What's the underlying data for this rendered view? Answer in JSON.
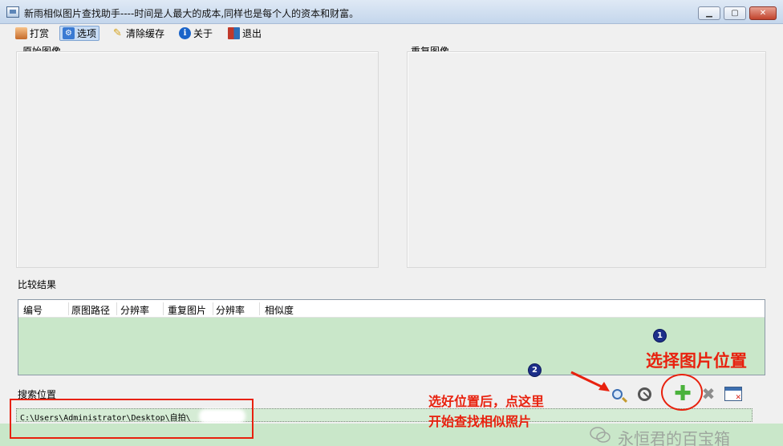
{
  "window": {
    "title": "新雨相似图片查找助手----时间是人最大的成本,同样也是每个人的资本和财富。"
  },
  "menu": [
    {
      "label": "打赏",
      "icon": "reward-icon"
    },
    {
      "label": "选项",
      "icon": "options-icon",
      "active": true
    },
    {
      "label": "清除缓存",
      "icon": "broom-icon"
    },
    {
      "label": "关于",
      "icon": "info-icon"
    },
    {
      "label": "退出",
      "icon": "exit-icon"
    }
  ],
  "panels": {
    "original_label": "原始图像",
    "duplicate_label": "重复图像"
  },
  "results": {
    "label": "比较结果",
    "columns": [
      "编号",
      "原图路径",
      "分辨率",
      "重复图片",
      "分辨率",
      "相似度"
    ],
    "rows": []
  },
  "search": {
    "label": "搜索位置",
    "path": "C:\\Users\\Administrator\\Desktop\\自拍\\"
  },
  "annotations": {
    "step1_number": "1",
    "step1_text": "选择图片位置",
    "step2_number": "2",
    "step2_text_line1": "选好位置后，点这里",
    "step2_text_line2": "开始查找相似照片",
    "annotation_color": "#e8210e"
  },
  "watermark": "永恒君的百宝箱"
}
